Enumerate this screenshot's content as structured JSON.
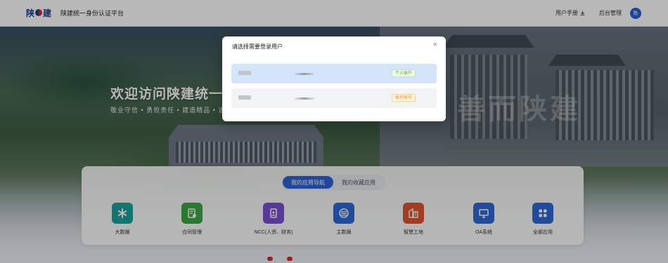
{
  "header": {
    "logo_text": "陕",
    "logo_text2": "建",
    "logo_sub": "",
    "platform_title": "陕建统一身份认证平台",
    "user_manual": "用户手册",
    "backend": "后台管理",
    "avatar_initial": "陈"
  },
  "hero": {
    "welcome_title": "欢迎访问陕建统一",
    "welcome_sub": "敬业守信 • 勇担责任 • 建造精品 • 追",
    "watermark": "善而陕建"
  },
  "apps_panel": {
    "tabs": [
      {
        "label": "我的应用导航",
        "active": true
      },
      {
        "label": "我的收藏应用",
        "active": false
      }
    ],
    "apps": [
      {
        "label": "大数据",
        "color": "#1aa39a",
        "icon": "asterisk-icon"
      },
      {
        "label": "合同管理",
        "color": "#3aa845",
        "icon": "contract-icon"
      },
      {
        "label": "NCC(人资、财务)",
        "color": "#7b4fd4",
        "icon": "id-card-icon"
      },
      {
        "label": "主数据",
        "color": "#2f6ad8",
        "icon": "database-icon"
      },
      {
        "label": "智慧工地",
        "color": "#e2552f",
        "icon": "building-icon"
      },
      {
        "label": "OA系统",
        "color": "#2f6ad8",
        "icon": "monitor-icon"
      },
      {
        "label": "全部应用",
        "color": "#2f6ad8",
        "icon": "grid-icon"
      }
    ]
  },
  "bottom_strip": {
    "items": [
      "",
      "",
      "",
      ""
    ]
  },
  "modal": {
    "title": "请选择需要登录用户",
    "close": "×",
    "accounts": [
      {
        "tag": "个人账户",
        "tag_type": "personal",
        "selected": true
      },
      {
        "tag": "委托账号",
        "tag_type": "partner",
        "selected": false
      }
    ]
  }
}
